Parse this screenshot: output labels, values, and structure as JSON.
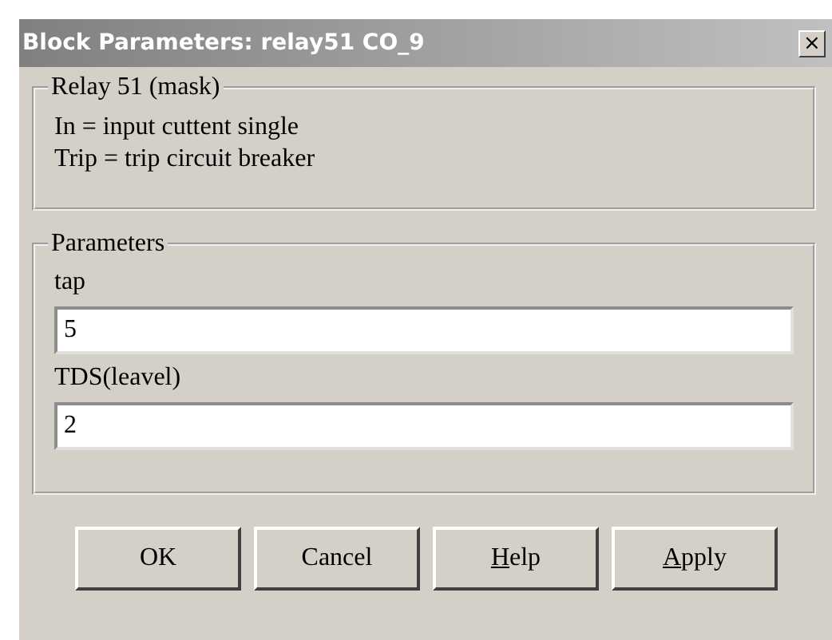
{
  "window": {
    "title": "Block Parameters: relay51 CO_9",
    "close": "×"
  },
  "description": {
    "title": "Relay 51 (mask)",
    "lines": [
      "In = input cuttent single",
      "Trip = trip circuit breaker"
    ]
  },
  "parameters": {
    "title": "Parameters",
    "fields": [
      {
        "label": "tap",
        "value": "5"
      },
      {
        "label": "TDS(leavel)",
        "value": "2"
      }
    ]
  },
  "buttons": [
    {
      "label": "OK"
    },
    {
      "label": "Cancel"
    },
    {
      "underlined": "H",
      "label": "elp"
    },
    {
      "underlined": "A",
      "label": "pply"
    }
  ]
}
